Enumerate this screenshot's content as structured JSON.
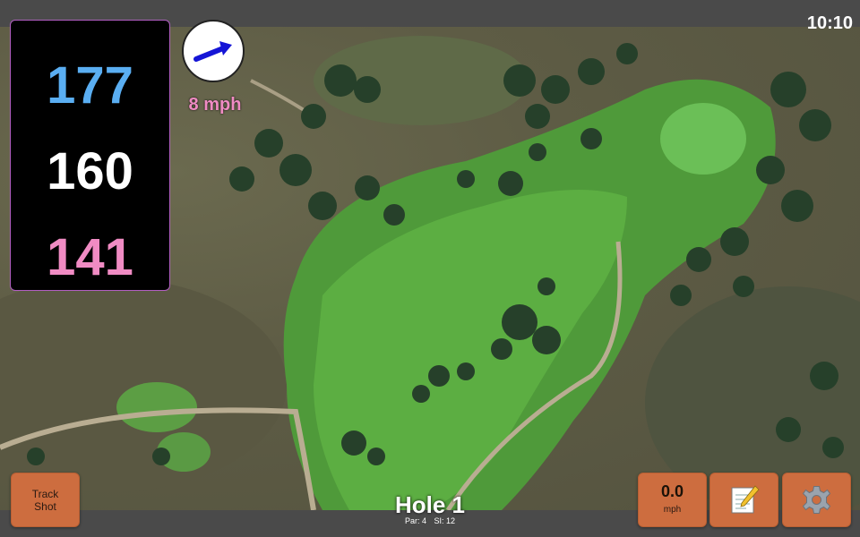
{
  "status": {
    "time": "10:10"
  },
  "distances": {
    "back": "177",
    "middle": "160",
    "front": "141"
  },
  "wind": {
    "speed": "8 mph",
    "icon": "wind-arrow-icon"
  },
  "hole": {
    "title": "Hole 1",
    "par": "Par: 4",
    "stroke_index": "SI: 12"
  },
  "buttons": {
    "track_shot_line1": "Track",
    "track_shot_line2": "Shot",
    "speed_value": "0.0",
    "speed_unit": "mph",
    "notes_icon": "notepad-icon",
    "settings_icon": "gear-icon"
  },
  "colors": {
    "back_distance": "#5aaef2",
    "middle_distance": "#ffffff",
    "front_distance": "#f08bc3",
    "button": "#cd6d3f",
    "panel_border": "#b25fc2"
  }
}
